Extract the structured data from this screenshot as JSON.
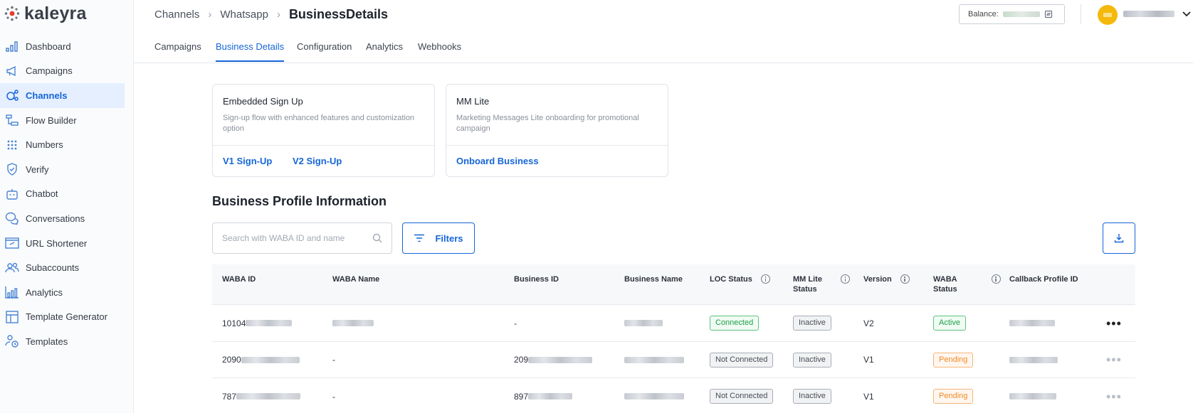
{
  "brand": {
    "name": "kaleyra"
  },
  "sidebar": {
    "items": [
      {
        "label": "Dashboard",
        "icon": "bar-chart-icon"
      },
      {
        "label": "Campaigns",
        "icon": "megaphone-icon"
      },
      {
        "label": "Channels",
        "icon": "channels-icon",
        "active": true
      },
      {
        "label": "Flow Builder",
        "icon": "flow-builder-icon"
      },
      {
        "label": "Numbers",
        "icon": "dial-pad-icon"
      },
      {
        "label": "Verify",
        "icon": "shield-check-icon"
      },
      {
        "label": "Chatbot",
        "icon": "robot-icon"
      },
      {
        "label": "Conversations",
        "icon": "chat-bubbles-icon"
      },
      {
        "label": "URL Shortener",
        "icon": "link-icon"
      },
      {
        "label": "Subaccounts",
        "icon": "users-icon"
      },
      {
        "label": "Analytics",
        "icon": "analytics-icon"
      },
      {
        "label": "Template Generator",
        "icon": "layout-icon"
      },
      {
        "label": "Templates",
        "icon": "templates-icon"
      }
    ]
  },
  "header": {
    "breadcrumb": [
      "Channels",
      "Whatsapp",
      "BusinessDetails"
    ],
    "balance_label": "Balance:"
  },
  "tabs": [
    "Campaigns",
    "Business Details",
    "Configuration",
    "Analytics",
    "Webhooks"
  ],
  "active_tab": "Business Details",
  "cards": [
    {
      "title": "Embedded Sign Up",
      "description": "Sign-up flow with enhanced features and customization option",
      "links": [
        "V1 Sign-Up",
        "V2 Sign-Up"
      ]
    },
    {
      "title": "MM Lite",
      "description": "Marketing Messages Lite onboarding for promotional campaign",
      "links": [
        "Onboard Business"
      ]
    }
  ],
  "section_title": "Business Profile Information",
  "search": {
    "placeholder": "Search with WABA ID and name"
  },
  "filters_label": "Filters",
  "table": {
    "headers": {
      "waba_id": "WABA ID",
      "waba_name": "WABA Name",
      "business_id": "Business ID",
      "business_name": "Business Name",
      "loc_status": "LOC Status",
      "mm_lite_status_1": "MM Lite",
      "mm_lite_status_2": "Status",
      "version": "Version",
      "waba_status_1": "WABA",
      "waba_status_2": "Status",
      "callback_profile_id": "Callback Profile ID"
    },
    "rows": [
      {
        "waba_id_prefix": "10104",
        "waba_name": "",
        "business_id_prefix": "-",
        "loc_status": "Connected",
        "mm_lite_status": "Inactive",
        "version": "V2",
        "waba_status": "Active"
      },
      {
        "waba_id_prefix": "2090",
        "waba_name": "-",
        "business_id_prefix": "209",
        "loc_status": "Not Connected",
        "mm_lite_status": "Inactive",
        "version": "V1",
        "waba_status": "Pending"
      },
      {
        "waba_id_prefix": "787",
        "waba_name": "-",
        "business_id_prefix": "897",
        "loc_status": "Not Connected",
        "mm_lite_status": "Inactive",
        "version": "V1",
        "waba_status": "Pending"
      }
    ]
  },
  "colors": {
    "accent": "#1565d8",
    "active_nav_bg": "#e5efff",
    "success": "#1e9e4a",
    "pending": "#f08a24",
    "avatar": "#f5b90c"
  }
}
